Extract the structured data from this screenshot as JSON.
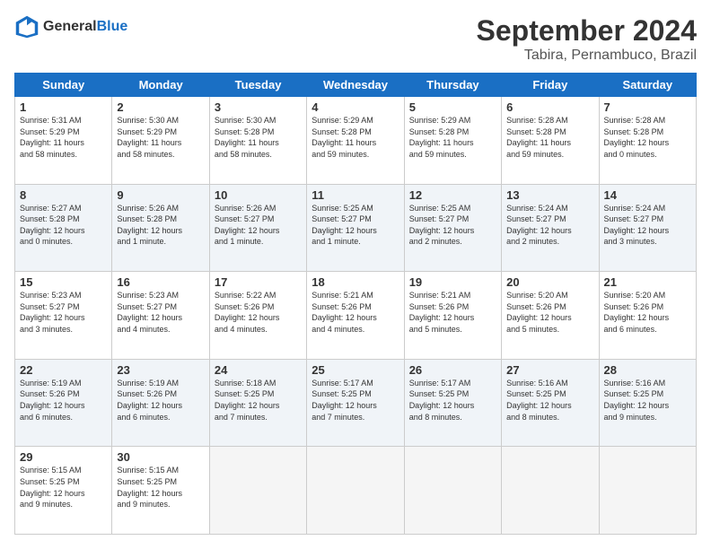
{
  "header": {
    "logo_general": "General",
    "logo_blue": "Blue",
    "title": "September 2024",
    "subtitle": "Tabira, Pernambuco, Brazil"
  },
  "columns": [
    "Sunday",
    "Monday",
    "Tuesday",
    "Wednesday",
    "Thursday",
    "Friday",
    "Saturday"
  ],
  "weeks": [
    [
      {
        "num": "1",
        "info": "Sunrise: 5:31 AM\nSunset: 5:29 PM\nDaylight: 11 hours\nand 58 minutes."
      },
      {
        "num": "2",
        "info": "Sunrise: 5:30 AM\nSunset: 5:29 PM\nDaylight: 11 hours\nand 58 minutes."
      },
      {
        "num": "3",
        "info": "Sunrise: 5:30 AM\nSunset: 5:28 PM\nDaylight: 11 hours\nand 58 minutes."
      },
      {
        "num": "4",
        "info": "Sunrise: 5:29 AM\nSunset: 5:28 PM\nDaylight: 11 hours\nand 59 minutes."
      },
      {
        "num": "5",
        "info": "Sunrise: 5:29 AM\nSunset: 5:28 PM\nDaylight: 11 hours\nand 59 minutes."
      },
      {
        "num": "6",
        "info": "Sunrise: 5:28 AM\nSunset: 5:28 PM\nDaylight: 11 hours\nand 59 minutes."
      },
      {
        "num": "7",
        "info": "Sunrise: 5:28 AM\nSunset: 5:28 PM\nDaylight: 12 hours\nand 0 minutes."
      }
    ],
    [
      {
        "num": "8",
        "info": "Sunrise: 5:27 AM\nSunset: 5:28 PM\nDaylight: 12 hours\nand 0 minutes."
      },
      {
        "num": "9",
        "info": "Sunrise: 5:26 AM\nSunset: 5:28 PM\nDaylight: 12 hours\nand 1 minute."
      },
      {
        "num": "10",
        "info": "Sunrise: 5:26 AM\nSunset: 5:27 PM\nDaylight: 12 hours\nand 1 minute."
      },
      {
        "num": "11",
        "info": "Sunrise: 5:25 AM\nSunset: 5:27 PM\nDaylight: 12 hours\nand 1 minute."
      },
      {
        "num": "12",
        "info": "Sunrise: 5:25 AM\nSunset: 5:27 PM\nDaylight: 12 hours\nand 2 minutes."
      },
      {
        "num": "13",
        "info": "Sunrise: 5:24 AM\nSunset: 5:27 PM\nDaylight: 12 hours\nand 2 minutes."
      },
      {
        "num": "14",
        "info": "Sunrise: 5:24 AM\nSunset: 5:27 PM\nDaylight: 12 hours\nand 3 minutes."
      }
    ],
    [
      {
        "num": "15",
        "info": "Sunrise: 5:23 AM\nSunset: 5:27 PM\nDaylight: 12 hours\nand 3 minutes."
      },
      {
        "num": "16",
        "info": "Sunrise: 5:23 AM\nSunset: 5:27 PM\nDaylight: 12 hours\nand 4 minutes."
      },
      {
        "num": "17",
        "info": "Sunrise: 5:22 AM\nSunset: 5:26 PM\nDaylight: 12 hours\nand 4 minutes."
      },
      {
        "num": "18",
        "info": "Sunrise: 5:21 AM\nSunset: 5:26 PM\nDaylight: 12 hours\nand 4 minutes."
      },
      {
        "num": "19",
        "info": "Sunrise: 5:21 AM\nSunset: 5:26 PM\nDaylight: 12 hours\nand 5 minutes."
      },
      {
        "num": "20",
        "info": "Sunrise: 5:20 AM\nSunset: 5:26 PM\nDaylight: 12 hours\nand 5 minutes."
      },
      {
        "num": "21",
        "info": "Sunrise: 5:20 AM\nSunset: 5:26 PM\nDaylight: 12 hours\nand 6 minutes."
      }
    ],
    [
      {
        "num": "22",
        "info": "Sunrise: 5:19 AM\nSunset: 5:26 PM\nDaylight: 12 hours\nand 6 minutes."
      },
      {
        "num": "23",
        "info": "Sunrise: 5:19 AM\nSunset: 5:26 PM\nDaylight: 12 hours\nand 6 minutes."
      },
      {
        "num": "24",
        "info": "Sunrise: 5:18 AM\nSunset: 5:25 PM\nDaylight: 12 hours\nand 7 minutes."
      },
      {
        "num": "25",
        "info": "Sunrise: 5:17 AM\nSunset: 5:25 PM\nDaylight: 12 hours\nand 7 minutes."
      },
      {
        "num": "26",
        "info": "Sunrise: 5:17 AM\nSunset: 5:25 PM\nDaylight: 12 hours\nand 8 minutes."
      },
      {
        "num": "27",
        "info": "Sunrise: 5:16 AM\nSunset: 5:25 PM\nDaylight: 12 hours\nand 8 minutes."
      },
      {
        "num": "28",
        "info": "Sunrise: 5:16 AM\nSunset: 5:25 PM\nDaylight: 12 hours\nand 9 minutes."
      }
    ],
    [
      {
        "num": "29",
        "info": "Sunrise: 5:15 AM\nSunset: 5:25 PM\nDaylight: 12 hours\nand 9 minutes."
      },
      {
        "num": "30",
        "info": "Sunrise: 5:15 AM\nSunset: 5:25 PM\nDaylight: 12 hours\nand 9 minutes."
      },
      {
        "num": "",
        "info": ""
      },
      {
        "num": "",
        "info": ""
      },
      {
        "num": "",
        "info": ""
      },
      {
        "num": "",
        "info": ""
      },
      {
        "num": "",
        "info": ""
      }
    ]
  ]
}
